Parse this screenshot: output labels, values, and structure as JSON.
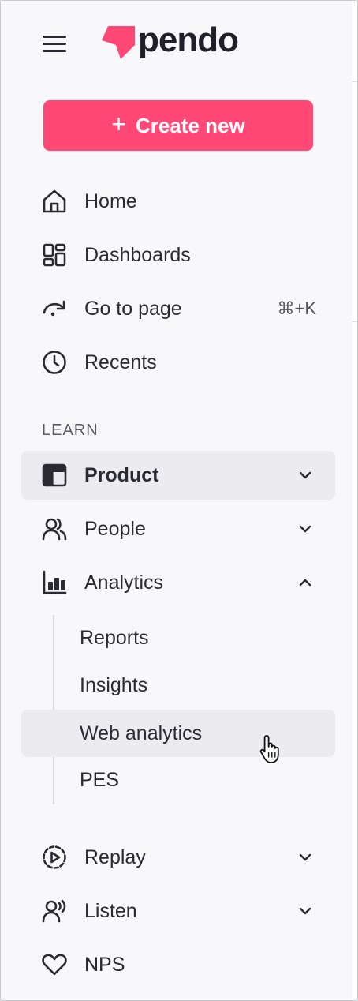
{
  "brand": {
    "name": "pendo",
    "accent": "#ff4876"
  },
  "header": {
    "menu_icon": "hamburger-icon"
  },
  "create_button": {
    "label": "Create new",
    "icon": "plus-icon"
  },
  "nav_top": [
    {
      "label": "Home",
      "icon": "home-icon"
    },
    {
      "label": "Dashboards",
      "icon": "dashboards-icon"
    },
    {
      "label": "Go to page",
      "icon": "go-to-page-icon",
      "shortcut": "⌘+K"
    },
    {
      "label": "Recents",
      "icon": "clock-icon"
    }
  ],
  "section_learn": {
    "title": "LEARN"
  },
  "nav_learn": [
    {
      "label": "Product",
      "icon": "product-icon",
      "state": "collapsed",
      "active": true
    },
    {
      "label": "People",
      "icon": "people-icon",
      "state": "collapsed"
    },
    {
      "label": "Analytics",
      "icon": "analytics-icon",
      "state": "expanded"
    }
  ],
  "analytics_sub": [
    {
      "label": "Reports"
    },
    {
      "label": "Insights"
    },
    {
      "label": "Web analytics",
      "hover": true
    },
    {
      "label": "PES"
    }
  ],
  "nav_bottom": [
    {
      "label": "Replay",
      "icon": "replay-icon",
      "state": "collapsed"
    },
    {
      "label": "Listen",
      "icon": "listen-icon",
      "state": "collapsed"
    },
    {
      "label": "NPS",
      "icon": "heart-icon"
    }
  ],
  "pointer": {
    "icon": "hand-pointer-icon"
  }
}
